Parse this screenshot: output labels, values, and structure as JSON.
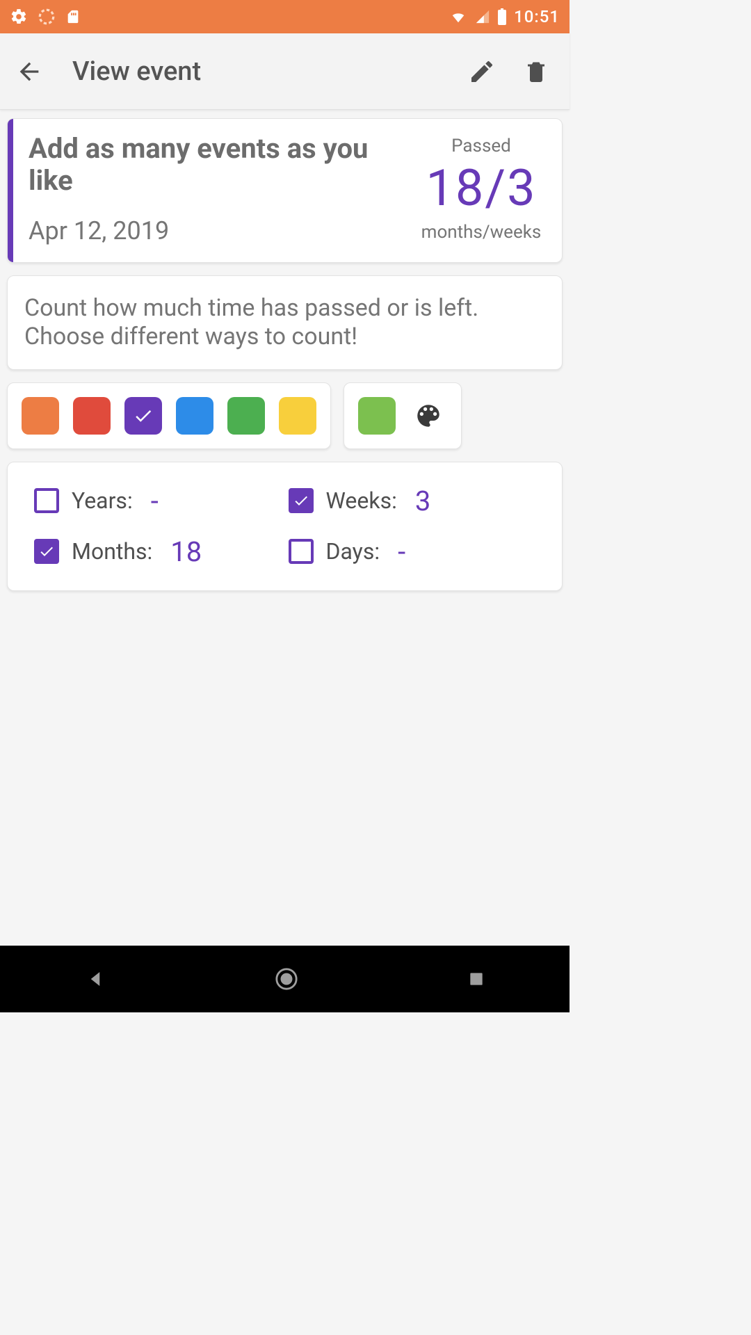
{
  "status": {
    "time": "10:51"
  },
  "appbar": {
    "title": "View event"
  },
  "event": {
    "title": "Add as many events as you like",
    "date": "Apr 12, 2019",
    "passed_label": "Passed",
    "passed_value": "18/3",
    "passed_unit": "months/weeks",
    "accent_color": "#673ab7"
  },
  "description": "Count how much time has passed or is left. Choose different ways to count!",
  "colors": {
    "presets": [
      {
        "name": "orange",
        "hex": "#ed7d44",
        "selected": false
      },
      {
        "name": "red",
        "hex": "#e04b3c",
        "selected": false
      },
      {
        "name": "purple",
        "hex": "#673ab7",
        "selected": true
      },
      {
        "name": "blue",
        "hex": "#2d8ce8",
        "selected": false
      },
      {
        "name": "green",
        "hex": "#4caf50",
        "selected": false
      },
      {
        "name": "yellow",
        "hex": "#f8cf3c",
        "selected": false
      }
    ],
    "custom_preview": "#7cc04f"
  },
  "units": {
    "years": {
      "label": "Years:",
      "checked": false,
      "value": "-"
    },
    "weeks": {
      "label": "Weeks:",
      "checked": true,
      "value": "3"
    },
    "months": {
      "label": "Months:",
      "checked": true,
      "value": "18"
    },
    "days": {
      "label": "Days:",
      "checked": false,
      "value": "-"
    }
  }
}
